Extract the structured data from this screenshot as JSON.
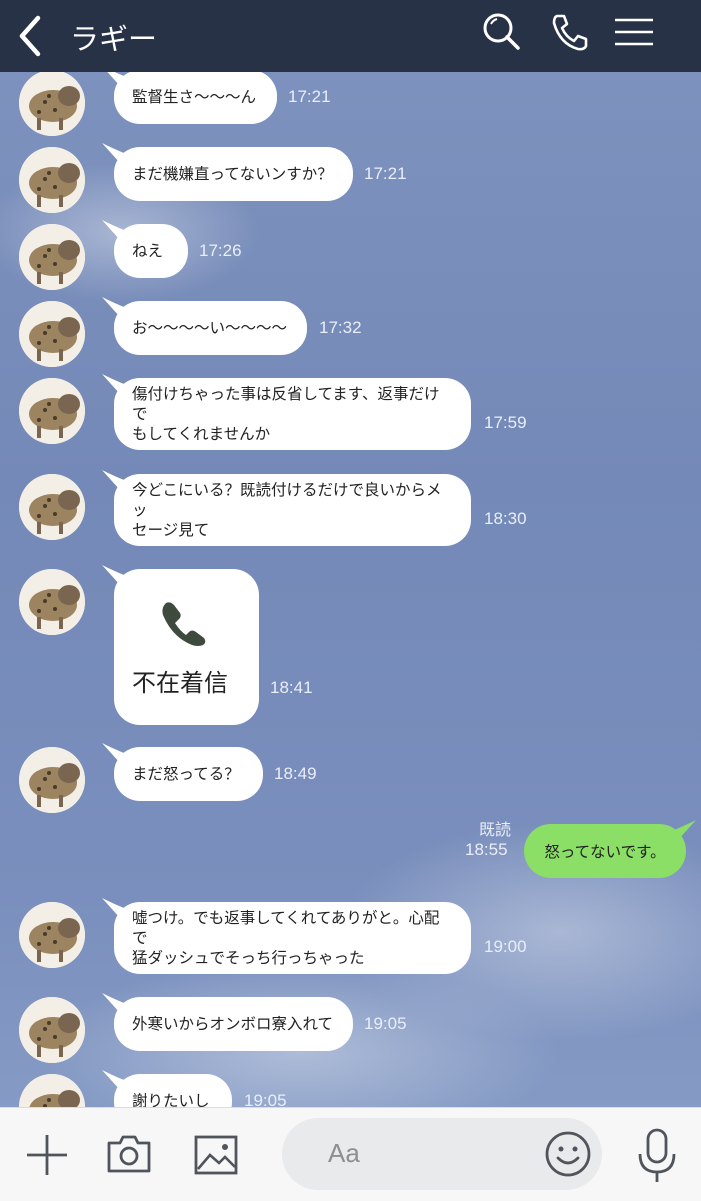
{
  "header": {
    "title": "ラギー"
  },
  "messages": [
    {
      "text": "監督生さ〜〜〜ん",
      "time": "17:21"
    },
    {
      "text": "まだ機嫌直ってないンすか？",
      "time": "17:21"
    },
    {
      "text": "ねえ",
      "time": "17:26"
    },
    {
      "text": "お〜〜〜〜い〜〜〜〜",
      "time": "17:32"
    },
    {
      "line1": "傷付けちゃった事は反省してます、返事だけで",
      "line2": "もしてくれませんか",
      "time": "17:59"
    },
    {
      "line1": "今どこにいる？既読付けるだけで良いからメッ",
      "line2": "セージ見て",
      "time": "18:30"
    },
    {
      "call_label": "不在着信",
      "time": "18:41"
    },
    {
      "text": "まだ怒ってる？",
      "time": "18:49"
    },
    {
      "line1": "嘘つけ。でも返事してくれてありがと。心配で",
      "line2": "猛ダッシュでそっち行っちゃった",
      "time": "19:00"
    },
    {
      "text": "外寒いからオンボロ寮入れて",
      "time": "19:05"
    },
    {
      "text": "謝りたいし",
      "time": "19:05"
    }
  ],
  "my_message": {
    "text": "怒ってないです。",
    "time": "18:55",
    "read": "既読"
  },
  "footer": {
    "input_placeholder": "Aa"
  },
  "colors": {
    "header_bg": "#273246",
    "my_bubble": "#8bde66",
    "chat_bg": "#7a8fbd"
  }
}
